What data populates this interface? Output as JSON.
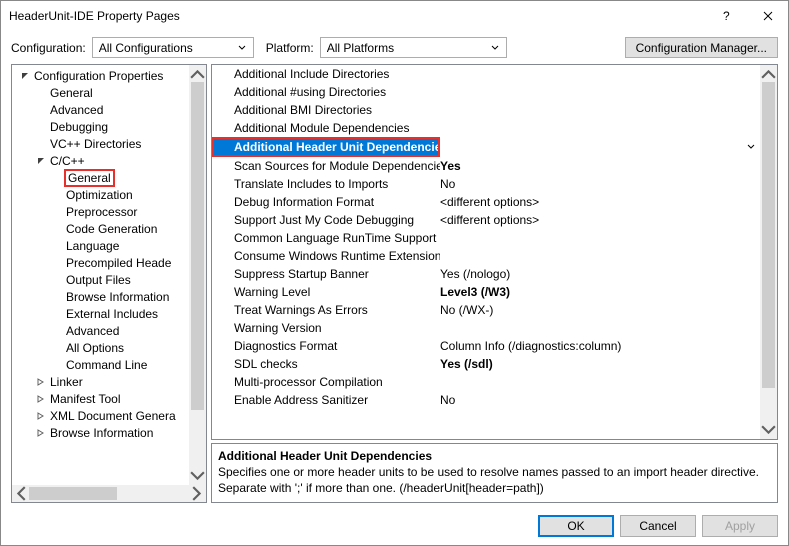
{
  "title": "HeaderUnit-IDE Property Pages",
  "topbar": {
    "configuration_label": "Configuration:",
    "configuration_value": "All Configurations",
    "platform_label": "Platform:",
    "platform_value": "All Platforms",
    "manager_label": "Configuration Manager..."
  },
  "tree": [
    {
      "depth": 0,
      "toggle": "open",
      "label": "Configuration Properties"
    },
    {
      "depth": 1,
      "toggle": "",
      "label": "General"
    },
    {
      "depth": 1,
      "toggle": "",
      "label": "Advanced"
    },
    {
      "depth": 1,
      "toggle": "",
      "label": "Debugging"
    },
    {
      "depth": 1,
      "toggle": "",
      "label": "VC++ Directories"
    },
    {
      "depth": 1,
      "toggle": "open",
      "label": "C/C++"
    },
    {
      "depth": 2,
      "toggle": "",
      "label": "General",
      "hl": true
    },
    {
      "depth": 2,
      "toggle": "",
      "label": "Optimization"
    },
    {
      "depth": 2,
      "toggle": "",
      "label": "Preprocessor"
    },
    {
      "depth": 2,
      "toggle": "",
      "label": "Code Generation"
    },
    {
      "depth": 2,
      "toggle": "",
      "label": "Language"
    },
    {
      "depth": 2,
      "toggle": "",
      "label": "Precompiled Heade"
    },
    {
      "depth": 2,
      "toggle": "",
      "label": "Output Files"
    },
    {
      "depth": 2,
      "toggle": "",
      "label": "Browse Information"
    },
    {
      "depth": 2,
      "toggle": "",
      "label": "External Includes"
    },
    {
      "depth": 2,
      "toggle": "",
      "label": "Advanced"
    },
    {
      "depth": 2,
      "toggle": "",
      "label": "All Options"
    },
    {
      "depth": 2,
      "toggle": "",
      "label": "Command Line"
    },
    {
      "depth": 1,
      "toggle": "closed",
      "label": "Linker"
    },
    {
      "depth": 1,
      "toggle": "closed",
      "label": "Manifest Tool"
    },
    {
      "depth": 1,
      "toggle": "closed",
      "label": "XML Document Genera"
    },
    {
      "depth": 1,
      "toggle": "closed",
      "label": "Browse Information"
    }
  ],
  "grid": [
    {
      "name": "Additional Include Directories",
      "value": ""
    },
    {
      "name": "Additional #using Directories",
      "value": ""
    },
    {
      "name": "Additional BMI Directories",
      "value": ""
    },
    {
      "name": "Additional Module Dependencies",
      "value": ""
    },
    {
      "name": "Additional Header Unit Dependencies",
      "value": "",
      "sel": true
    },
    {
      "name": "Scan Sources for Module Dependencies",
      "value": "Yes",
      "bold": true
    },
    {
      "name": "Translate Includes to Imports",
      "value": "No"
    },
    {
      "name": "Debug Information Format",
      "value": "<different options>"
    },
    {
      "name": "Support Just My Code Debugging",
      "value": "<different options>"
    },
    {
      "name": "Common Language RunTime Support",
      "value": ""
    },
    {
      "name": "Consume Windows Runtime Extension",
      "value": ""
    },
    {
      "name": "Suppress Startup Banner",
      "value": "Yes (/nologo)"
    },
    {
      "name": "Warning Level",
      "value": "Level3 (/W3)",
      "bold": true
    },
    {
      "name": "Treat Warnings As Errors",
      "value": "No (/WX-)"
    },
    {
      "name": "Warning Version",
      "value": ""
    },
    {
      "name": "Diagnostics Format",
      "value": "Column Info (/diagnostics:column)"
    },
    {
      "name": "SDL checks",
      "value": "Yes (/sdl)",
      "bold": true
    },
    {
      "name": "Multi-processor Compilation",
      "value": ""
    },
    {
      "name": "Enable Address Sanitizer",
      "value": "No"
    }
  ],
  "desc": {
    "title": "Additional Header Unit Dependencies",
    "body": "Specifies one or more header units to be used to resolve names passed to an import header directive. Separate with ';' if more than one.  (/headerUnit[header=path])"
  },
  "buttons": {
    "ok": "OK",
    "cancel": "Cancel",
    "apply": "Apply"
  }
}
